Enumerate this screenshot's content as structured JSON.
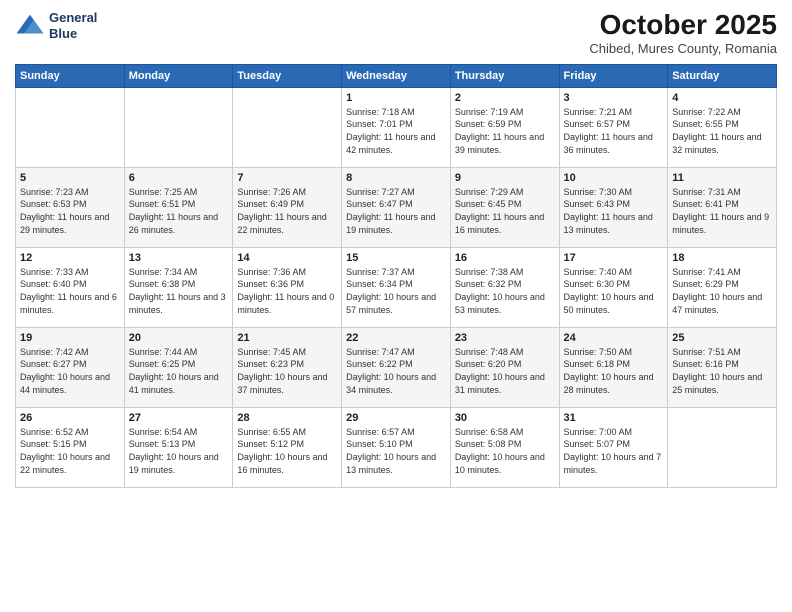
{
  "header": {
    "logo_line1": "General",
    "logo_line2": "Blue",
    "month": "October 2025",
    "location": "Chibed, Mures County, Romania"
  },
  "weekdays": [
    "Sunday",
    "Monday",
    "Tuesday",
    "Wednesday",
    "Thursday",
    "Friday",
    "Saturday"
  ],
  "weeks": [
    [
      {
        "day": "",
        "content": ""
      },
      {
        "day": "",
        "content": ""
      },
      {
        "day": "",
        "content": ""
      },
      {
        "day": "1",
        "content": "Sunrise: 7:18 AM\nSunset: 7:01 PM\nDaylight: 11 hours\nand 42 minutes."
      },
      {
        "day": "2",
        "content": "Sunrise: 7:19 AM\nSunset: 6:59 PM\nDaylight: 11 hours\nand 39 minutes."
      },
      {
        "day": "3",
        "content": "Sunrise: 7:21 AM\nSunset: 6:57 PM\nDaylight: 11 hours\nand 36 minutes."
      },
      {
        "day": "4",
        "content": "Sunrise: 7:22 AM\nSunset: 6:55 PM\nDaylight: 11 hours\nand 32 minutes."
      }
    ],
    [
      {
        "day": "5",
        "content": "Sunrise: 7:23 AM\nSunset: 6:53 PM\nDaylight: 11 hours\nand 29 minutes."
      },
      {
        "day": "6",
        "content": "Sunrise: 7:25 AM\nSunset: 6:51 PM\nDaylight: 11 hours\nand 26 minutes."
      },
      {
        "day": "7",
        "content": "Sunrise: 7:26 AM\nSunset: 6:49 PM\nDaylight: 11 hours\nand 22 minutes."
      },
      {
        "day": "8",
        "content": "Sunrise: 7:27 AM\nSunset: 6:47 PM\nDaylight: 11 hours\nand 19 minutes."
      },
      {
        "day": "9",
        "content": "Sunrise: 7:29 AM\nSunset: 6:45 PM\nDaylight: 11 hours\nand 16 minutes."
      },
      {
        "day": "10",
        "content": "Sunrise: 7:30 AM\nSunset: 6:43 PM\nDaylight: 11 hours\nand 13 minutes."
      },
      {
        "day": "11",
        "content": "Sunrise: 7:31 AM\nSunset: 6:41 PM\nDaylight: 11 hours\nand 9 minutes."
      }
    ],
    [
      {
        "day": "12",
        "content": "Sunrise: 7:33 AM\nSunset: 6:40 PM\nDaylight: 11 hours\nand 6 minutes."
      },
      {
        "day": "13",
        "content": "Sunrise: 7:34 AM\nSunset: 6:38 PM\nDaylight: 11 hours\nand 3 minutes."
      },
      {
        "day": "14",
        "content": "Sunrise: 7:36 AM\nSunset: 6:36 PM\nDaylight: 11 hours\nand 0 minutes."
      },
      {
        "day": "15",
        "content": "Sunrise: 7:37 AM\nSunset: 6:34 PM\nDaylight: 10 hours\nand 57 minutes."
      },
      {
        "day": "16",
        "content": "Sunrise: 7:38 AM\nSunset: 6:32 PM\nDaylight: 10 hours\nand 53 minutes."
      },
      {
        "day": "17",
        "content": "Sunrise: 7:40 AM\nSunset: 6:30 PM\nDaylight: 10 hours\nand 50 minutes."
      },
      {
        "day": "18",
        "content": "Sunrise: 7:41 AM\nSunset: 6:29 PM\nDaylight: 10 hours\nand 47 minutes."
      }
    ],
    [
      {
        "day": "19",
        "content": "Sunrise: 7:42 AM\nSunset: 6:27 PM\nDaylight: 10 hours\nand 44 minutes."
      },
      {
        "day": "20",
        "content": "Sunrise: 7:44 AM\nSunset: 6:25 PM\nDaylight: 10 hours\nand 41 minutes."
      },
      {
        "day": "21",
        "content": "Sunrise: 7:45 AM\nSunset: 6:23 PM\nDaylight: 10 hours\nand 37 minutes."
      },
      {
        "day": "22",
        "content": "Sunrise: 7:47 AM\nSunset: 6:22 PM\nDaylight: 10 hours\nand 34 minutes."
      },
      {
        "day": "23",
        "content": "Sunrise: 7:48 AM\nSunset: 6:20 PM\nDaylight: 10 hours\nand 31 minutes."
      },
      {
        "day": "24",
        "content": "Sunrise: 7:50 AM\nSunset: 6:18 PM\nDaylight: 10 hours\nand 28 minutes."
      },
      {
        "day": "25",
        "content": "Sunrise: 7:51 AM\nSunset: 6:16 PM\nDaylight: 10 hours\nand 25 minutes."
      }
    ],
    [
      {
        "day": "26",
        "content": "Sunrise: 6:52 AM\nSunset: 5:15 PM\nDaylight: 10 hours\nand 22 minutes."
      },
      {
        "day": "27",
        "content": "Sunrise: 6:54 AM\nSunset: 5:13 PM\nDaylight: 10 hours\nand 19 minutes."
      },
      {
        "day": "28",
        "content": "Sunrise: 6:55 AM\nSunset: 5:12 PM\nDaylight: 10 hours\nand 16 minutes."
      },
      {
        "day": "29",
        "content": "Sunrise: 6:57 AM\nSunset: 5:10 PM\nDaylight: 10 hours\nand 13 minutes."
      },
      {
        "day": "30",
        "content": "Sunrise: 6:58 AM\nSunset: 5:08 PM\nDaylight: 10 hours\nand 10 minutes."
      },
      {
        "day": "31",
        "content": "Sunrise: 7:00 AM\nSunset: 5:07 PM\nDaylight: 10 hours\nand 7 minutes."
      },
      {
        "day": "",
        "content": ""
      }
    ]
  ]
}
